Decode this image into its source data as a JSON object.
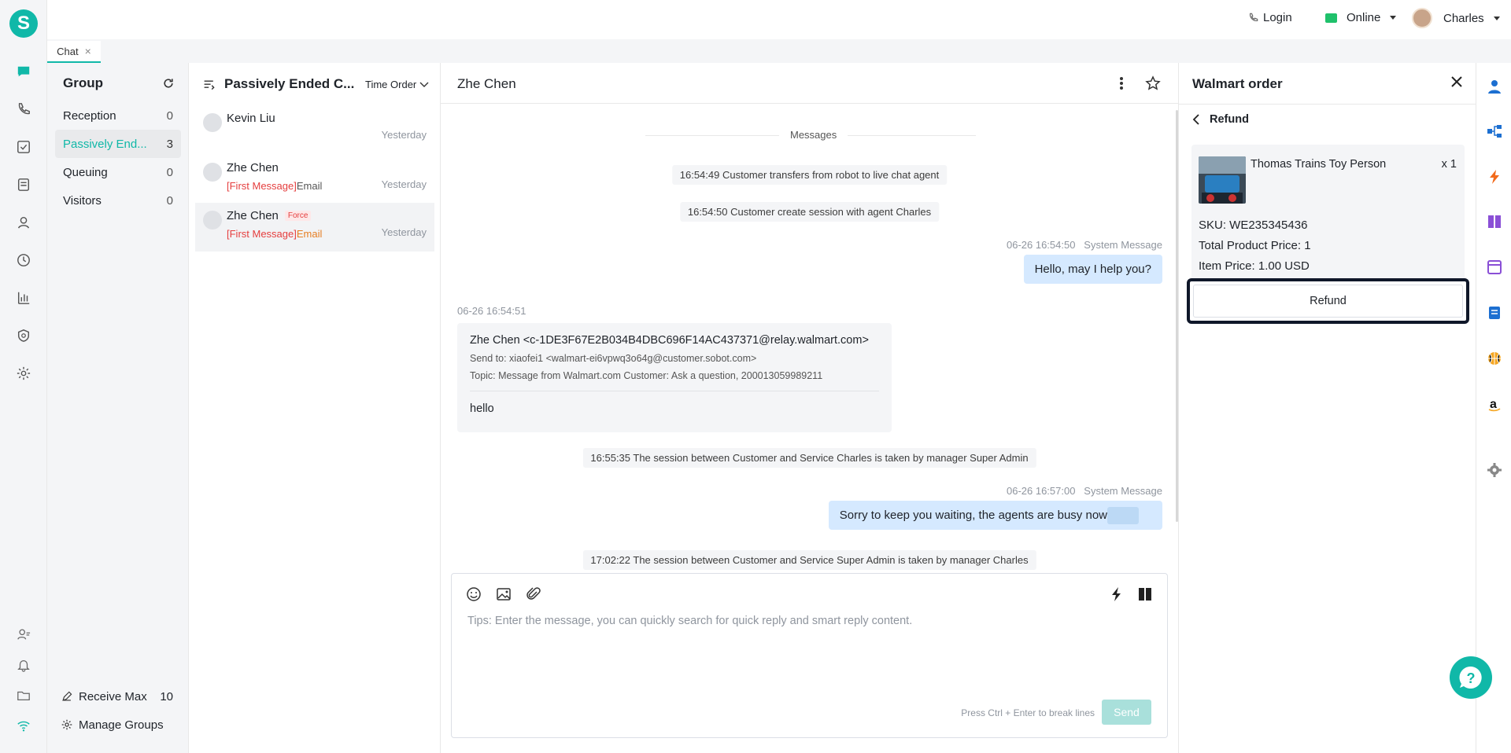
{
  "app": {
    "logo_letter": "S",
    "accent": "#10b8a8"
  },
  "topbar": {
    "login": "Login",
    "status": "Online",
    "user": "Charles"
  },
  "tabs": [
    {
      "label": "Chat",
      "close": "×"
    }
  ],
  "groups": {
    "title": "Group",
    "items": [
      {
        "label": "Reception",
        "count": "0"
      },
      {
        "label": "Passively End...",
        "count": "3"
      },
      {
        "label": "Queuing",
        "count": "0"
      },
      {
        "label": "Visitors",
        "count": "0"
      }
    ],
    "receive_max_label": "Receive Max",
    "receive_max_value": "10",
    "manage_groups": "Manage Groups"
  },
  "conv_list": {
    "title": "Passively Ended C...",
    "sort": "Time Order",
    "items": [
      {
        "name": "Kevin Liu",
        "badge": "",
        "prefix": "",
        "channel": "",
        "time": "Yesterday"
      },
      {
        "name": "Zhe Chen",
        "badge": "",
        "prefix": "[First Message]",
        "channel": "Email",
        "time": "Yesterday"
      },
      {
        "name": "Zhe Chen",
        "badge": "Force",
        "prefix": "[First Message]",
        "channel": "Email",
        "time": "Yesterday"
      }
    ]
  },
  "chat": {
    "contact": "Zhe Chen",
    "divider": "Messages",
    "sys1": "16:54:49 Customer transfers from robot to live chat agent",
    "sys2": "16:54:50 Customer create session with agent Charles",
    "msg1_time": "06-26 16:54:50",
    "msg1_sender": "System Message",
    "msg1_text": "Hello, may I help you?",
    "email_time": "06-26 16:54:51",
    "email_from": "Zhe Chen <c-1DE3F67E2B034B4DBC696F14AC437371@relay.walmart.com>",
    "email_to": "Send to: xiaofei1 <walmart-ei6vpwq3o64g@customer.sobot.com>",
    "email_topic": "Topic: Message from Walmart.com Customer:  Ask a question, 200013059989211",
    "email_body": "hello",
    "sys3": "16:55:35 The session between Customer and Service Charles is taken by manager Super Admin",
    "msg2_time": "06-26 16:57:00",
    "msg2_sender": "System Message",
    "msg2_text": "Sorry to keep you waiting, the agents are busy now",
    "sys4": "17:02:22 The session between Customer and Service Super Admin is taken by manager Charles",
    "composer_placeholder": "Tips: Enter the message, you can quickly search for quick reply and smart reply content.",
    "composer_hint": "Press Ctrl + Enter to break lines",
    "send": "Send"
  },
  "order": {
    "title": "Walmart order",
    "back_label": "Refund",
    "product_name": "Thomas Trains Toy Person",
    "quantity": "x 1",
    "sku": "SKU: WE235345436",
    "total": "Total Product Price: 1",
    "item_price": "Item Price: 1.00 USD",
    "refund_button": "Refund"
  }
}
